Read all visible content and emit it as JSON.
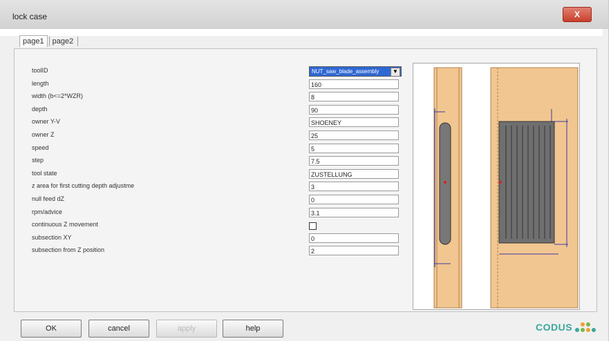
{
  "window": {
    "title": "lock case",
    "close_label": "X"
  },
  "tabs": [
    {
      "label": "page1"
    },
    {
      "label": "page2"
    }
  ],
  "form": {
    "fields": [
      {
        "label": "toolID",
        "value": "NUT_saw_blade_assembly",
        "kind": "select"
      },
      {
        "label": "length",
        "value": "160",
        "kind": "text"
      },
      {
        "label": "width (b<=2*WZR)",
        "value": "8",
        "kind": "text"
      },
      {
        "label": "depth",
        "value": "90",
        "kind": "text"
      },
      {
        "label": "owner Y-V",
        "value": "SHOENEY",
        "kind": "text"
      },
      {
        "label": "owner Z",
        "value": "25",
        "kind": "text"
      },
      {
        "label": "speed",
        "value": "5",
        "kind": "text"
      },
      {
        "label": "step",
        "value": "7.5",
        "kind": "text"
      },
      {
        "label": "tool state",
        "value": "ZUSTELLUNG",
        "kind": "text"
      },
      {
        "label": "z area for first cutting depth adjustme",
        "value": "3",
        "kind": "text"
      },
      {
        "label": "null feed dZ",
        "value": "0",
        "kind": "text"
      },
      {
        "label": "rpm/advice",
        "value": "3.1",
        "kind": "text"
      },
      {
        "label": "continuous Z movement",
        "value": "",
        "kind": "checkbox"
      },
      {
        "label": "subsection XY",
        "value": "0",
        "kind": "text"
      },
      {
        "label": "subsection from Z position",
        "value": "2",
        "kind": "text"
      }
    ]
  },
  "buttons": {
    "ok": "OK",
    "cancel": "cancel",
    "apply": "apply",
    "help": "help"
  },
  "logo": {
    "text": "CODUS"
  }
}
